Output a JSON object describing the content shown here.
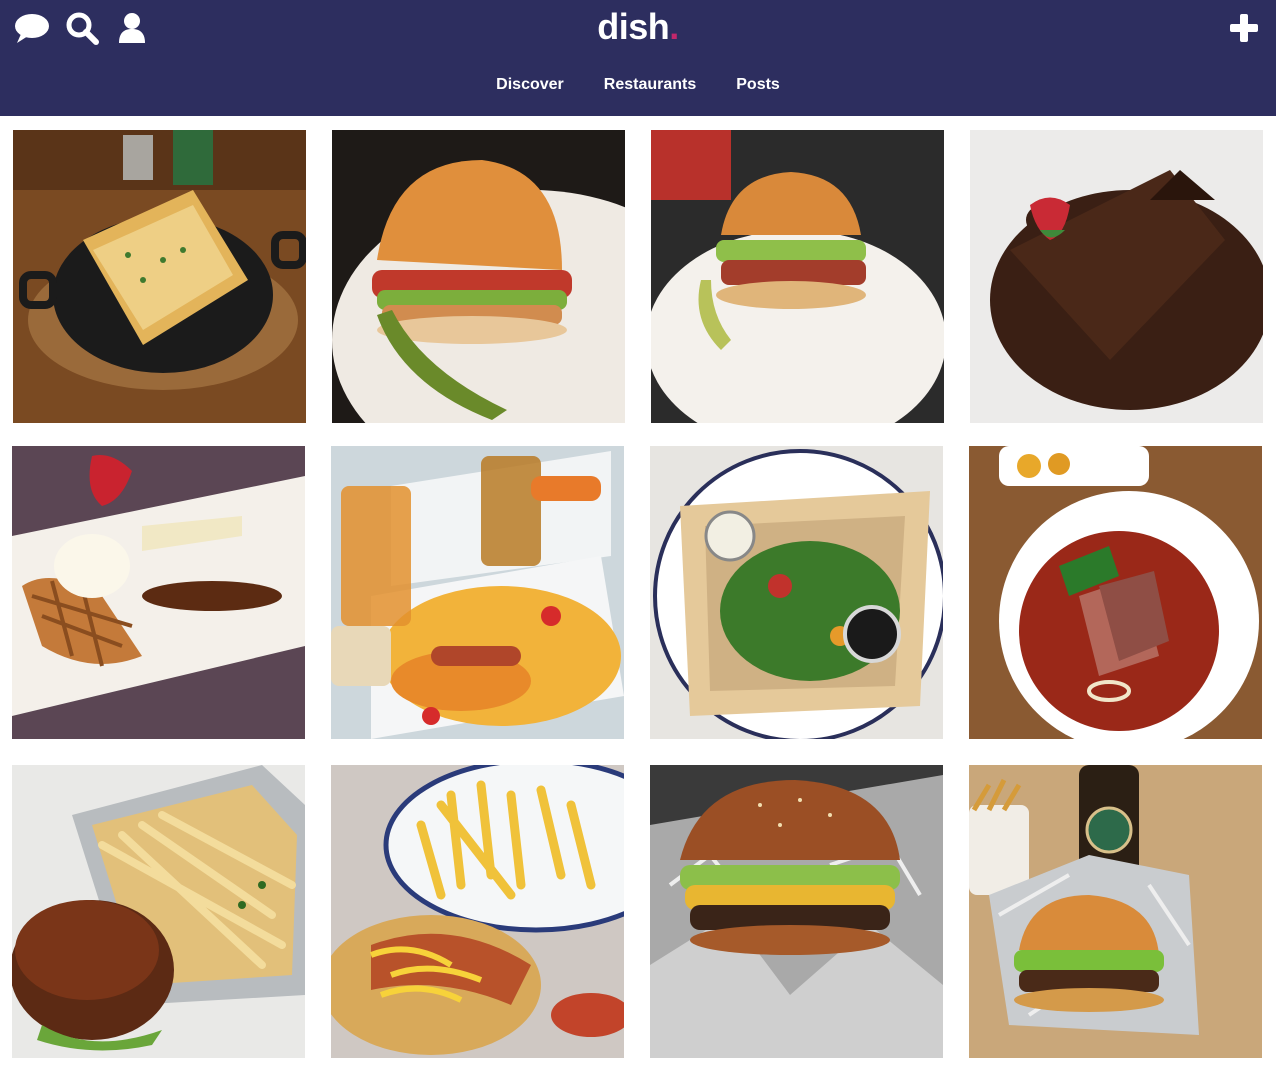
{
  "header": {
    "logo_text": "dish",
    "logo_dot": ".",
    "nav": [
      {
        "label": "Discover"
      },
      {
        "label": "Restaurants"
      },
      {
        "label": "Posts"
      }
    ],
    "icons": [
      "chat-icon",
      "search-icon",
      "user-icon",
      "plus-icon"
    ]
  },
  "colors": {
    "header_bg": "#2d2e5f",
    "logo_accent": "#c2276b"
  },
  "grid": {
    "columns": 4,
    "rows": 3,
    "tiles": [
      {
        "name": "food-photo-skillet"
      },
      {
        "name": "food-photo-burger-pickle"
      },
      {
        "name": "food-photo-bacon-burger"
      },
      {
        "name": "food-photo-chocolate-cake"
      },
      {
        "name": "food-photo-waffle-icecream"
      },
      {
        "name": "food-photo-pancakes-drinks"
      },
      {
        "name": "food-photo-flatbread-salad"
      },
      {
        "name": "food-photo-duck-breast"
      },
      {
        "name": "food-photo-burger-fries-tray"
      },
      {
        "name": "food-photo-fries-hotdog"
      },
      {
        "name": "food-photo-burger-foil"
      },
      {
        "name": "food-photo-burger-beer"
      }
    ]
  }
}
